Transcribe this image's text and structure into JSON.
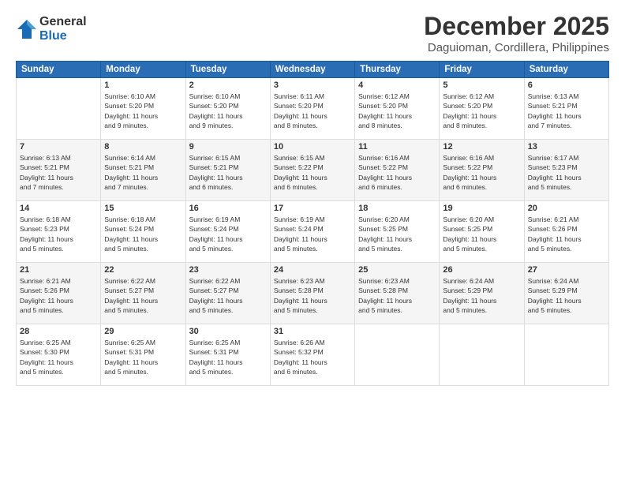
{
  "logo": {
    "general": "General",
    "blue": "Blue"
  },
  "title": "December 2025",
  "location": "Daguioman, Cordillera, Philippines",
  "weekdays": [
    "Sunday",
    "Monday",
    "Tuesday",
    "Wednesday",
    "Thursday",
    "Friday",
    "Saturday"
  ],
  "weeks": [
    [
      {
        "day": "",
        "info": ""
      },
      {
        "day": "1",
        "info": "Sunrise: 6:10 AM\nSunset: 5:20 PM\nDaylight: 11 hours\nand 9 minutes."
      },
      {
        "day": "2",
        "info": "Sunrise: 6:10 AM\nSunset: 5:20 PM\nDaylight: 11 hours\nand 9 minutes."
      },
      {
        "day": "3",
        "info": "Sunrise: 6:11 AM\nSunset: 5:20 PM\nDaylight: 11 hours\nand 8 minutes."
      },
      {
        "day": "4",
        "info": "Sunrise: 6:12 AM\nSunset: 5:20 PM\nDaylight: 11 hours\nand 8 minutes."
      },
      {
        "day": "5",
        "info": "Sunrise: 6:12 AM\nSunset: 5:20 PM\nDaylight: 11 hours\nand 8 minutes."
      },
      {
        "day": "6",
        "info": "Sunrise: 6:13 AM\nSunset: 5:21 PM\nDaylight: 11 hours\nand 7 minutes."
      }
    ],
    [
      {
        "day": "7",
        "info": "Sunrise: 6:13 AM\nSunset: 5:21 PM\nDaylight: 11 hours\nand 7 minutes."
      },
      {
        "day": "8",
        "info": "Sunrise: 6:14 AM\nSunset: 5:21 PM\nDaylight: 11 hours\nand 7 minutes."
      },
      {
        "day": "9",
        "info": "Sunrise: 6:15 AM\nSunset: 5:21 PM\nDaylight: 11 hours\nand 6 minutes."
      },
      {
        "day": "10",
        "info": "Sunrise: 6:15 AM\nSunset: 5:22 PM\nDaylight: 11 hours\nand 6 minutes."
      },
      {
        "day": "11",
        "info": "Sunrise: 6:16 AM\nSunset: 5:22 PM\nDaylight: 11 hours\nand 6 minutes."
      },
      {
        "day": "12",
        "info": "Sunrise: 6:16 AM\nSunset: 5:22 PM\nDaylight: 11 hours\nand 6 minutes."
      },
      {
        "day": "13",
        "info": "Sunrise: 6:17 AM\nSunset: 5:23 PM\nDaylight: 11 hours\nand 5 minutes."
      }
    ],
    [
      {
        "day": "14",
        "info": "Sunrise: 6:18 AM\nSunset: 5:23 PM\nDaylight: 11 hours\nand 5 minutes."
      },
      {
        "day": "15",
        "info": "Sunrise: 6:18 AM\nSunset: 5:24 PM\nDaylight: 11 hours\nand 5 minutes."
      },
      {
        "day": "16",
        "info": "Sunrise: 6:19 AM\nSunset: 5:24 PM\nDaylight: 11 hours\nand 5 minutes."
      },
      {
        "day": "17",
        "info": "Sunrise: 6:19 AM\nSunset: 5:24 PM\nDaylight: 11 hours\nand 5 minutes."
      },
      {
        "day": "18",
        "info": "Sunrise: 6:20 AM\nSunset: 5:25 PM\nDaylight: 11 hours\nand 5 minutes."
      },
      {
        "day": "19",
        "info": "Sunrise: 6:20 AM\nSunset: 5:25 PM\nDaylight: 11 hours\nand 5 minutes."
      },
      {
        "day": "20",
        "info": "Sunrise: 6:21 AM\nSunset: 5:26 PM\nDaylight: 11 hours\nand 5 minutes."
      }
    ],
    [
      {
        "day": "21",
        "info": "Sunrise: 6:21 AM\nSunset: 5:26 PM\nDaylight: 11 hours\nand 5 minutes."
      },
      {
        "day": "22",
        "info": "Sunrise: 6:22 AM\nSunset: 5:27 PM\nDaylight: 11 hours\nand 5 minutes."
      },
      {
        "day": "23",
        "info": "Sunrise: 6:22 AM\nSunset: 5:27 PM\nDaylight: 11 hours\nand 5 minutes."
      },
      {
        "day": "24",
        "info": "Sunrise: 6:23 AM\nSunset: 5:28 PM\nDaylight: 11 hours\nand 5 minutes."
      },
      {
        "day": "25",
        "info": "Sunrise: 6:23 AM\nSunset: 5:28 PM\nDaylight: 11 hours\nand 5 minutes."
      },
      {
        "day": "26",
        "info": "Sunrise: 6:24 AM\nSunset: 5:29 PM\nDaylight: 11 hours\nand 5 minutes."
      },
      {
        "day": "27",
        "info": "Sunrise: 6:24 AM\nSunset: 5:29 PM\nDaylight: 11 hours\nand 5 minutes."
      }
    ],
    [
      {
        "day": "28",
        "info": "Sunrise: 6:25 AM\nSunset: 5:30 PM\nDaylight: 11 hours\nand 5 minutes."
      },
      {
        "day": "29",
        "info": "Sunrise: 6:25 AM\nSunset: 5:31 PM\nDaylight: 11 hours\nand 5 minutes."
      },
      {
        "day": "30",
        "info": "Sunrise: 6:25 AM\nSunset: 5:31 PM\nDaylight: 11 hours\nand 5 minutes."
      },
      {
        "day": "31",
        "info": "Sunrise: 6:26 AM\nSunset: 5:32 PM\nDaylight: 11 hours\nand 6 minutes."
      },
      {
        "day": "",
        "info": ""
      },
      {
        "day": "",
        "info": ""
      },
      {
        "day": "",
        "info": ""
      }
    ]
  ]
}
